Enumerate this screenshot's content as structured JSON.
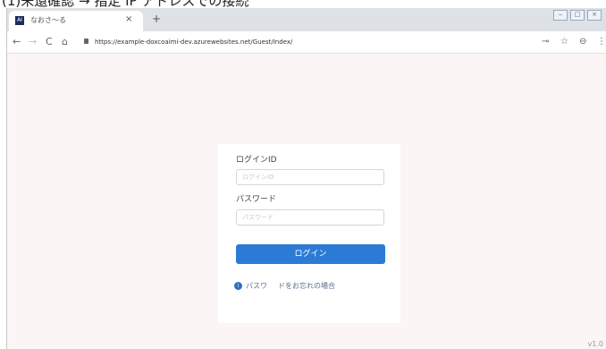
{
  "caption": "(1)未還確認 → 指定 IP アドレスでの接続",
  "browser": {
    "tab": {
      "favicon": "AI",
      "title": "なおさ～る",
      "close": "×"
    },
    "new_tab": "+",
    "window_controls": [
      "‒",
      "□",
      "×"
    ],
    "url": "https://example-doxcoaimi-dev.azurewebsites.net/Guest/Index/",
    "icons": {
      "back": "←",
      "forward": "→",
      "reload": "C",
      "home": "⌂",
      "key": "⊸",
      "star": "☆",
      "account": "⊖",
      "menu": "⋮"
    }
  },
  "login": {
    "id_label": "ログインID",
    "id_placeholder": "ログインID",
    "password_label": "パスワード",
    "password_placeholder": "パスワード",
    "submit_label": "ログイン",
    "help_icon": "i",
    "help_link_1": "パスワ",
    "help_link_2": "ドをお忘れの場合"
  },
  "footer": {
    "version": "v1.0"
  },
  "colors": {
    "accent": "#2b7bd6",
    "page_bg": "#fbf5f5",
    "tabstrip": "#dee1e6"
  }
}
